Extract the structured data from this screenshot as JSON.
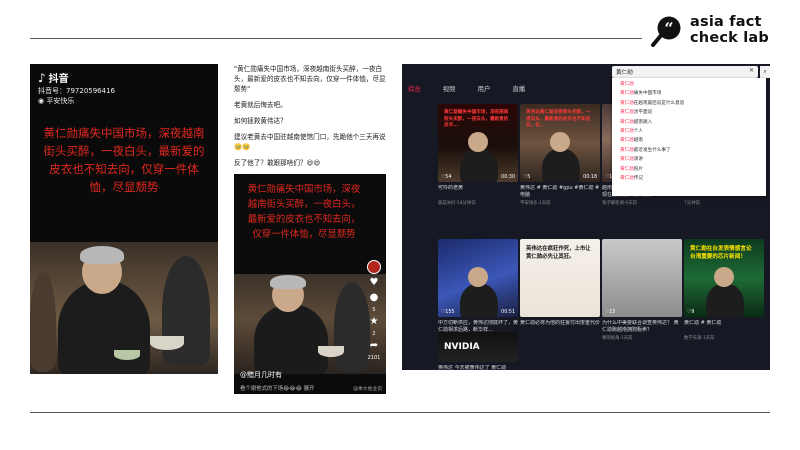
{
  "brand": {
    "line1": "asia fact",
    "line2": "check lab"
  },
  "panel1": {
    "app_name": "抖音",
    "account_id": "抖音号：79720596416",
    "location": "平安快乐",
    "caption": "黄仁勋痛失中国市场，深夜越南街头买醉，一夜白头，最新爱的皮衣也不知去向，仅穿一件体恤，尽显颓势"
  },
  "panel2": {
    "post_paragraphs": [
      "\"黄仁勋痛失中国市场，深夜越南街头买醉，一夜白头，最新爱的皮衣也不知去向，仅穿一件体恤，尽显颓势\"",
      "老黄就后悔去吧。",
      "如何拯救黄伟达？",
      "建议老黄去中国驻越南使馆门口，先跪他个三天再说🥺🥺",
      "反了他了？敢跟那啥们？😄😄"
    ],
    "video_caption": "黄仁勋痛失中国市场，深夜越南街头买醉，一夜白头，最新爱的皮衣也不知去向，仅穿一件体恤，尽显颓势",
    "counts": {
      "comments": "5",
      "share": "2",
      "likes": "2101"
    },
    "subtitle": "@黯月几时有",
    "footer": "看个谢他式的下场😂😂😂 展开",
    "watermark": "@季大他业讯"
  },
  "panel3": {
    "tabs": [
      "综合",
      "视频",
      "用户",
      "直播"
    ],
    "search_value": "黄仁勋",
    "suggestions": [
      {
        "hl": "黄仁勋",
        "rest": ""
      },
      {
        "hl": "黄仁勋",
        "rest": "痛失中国市场"
      },
      {
        "hl": "黄仁勋",
        "rest": "在越南最后说是什么意思"
      },
      {
        "hl": "黄仁勋",
        "rest": "涉平面说"
      },
      {
        "hl": "黄仁勋",
        "rest": "越南跳入"
      },
      {
        "hl": "黄仁勋",
        "rest": "个人"
      },
      {
        "hl": "黄仁勋",
        "rest": "越南"
      },
      {
        "hl": "黄仁勋",
        "rest": "最近发生什么事了"
      },
      {
        "hl": "黄仁勋",
        "rest": "演讲"
      },
      {
        "hl": "黄仁勋",
        "rest": "照片"
      },
      {
        "hl": "黄仁勋",
        "rest": "传记"
      }
    ],
    "cards": [
      {
        "title": "可怜的老黄",
        "meta": "蔬菜米好·54分钟前",
        "stat": "♡54",
        "dur": "00:30",
        "caption": "黄仁勋痛失中国市场，深夜越南街头买醉，一夜白头，最新爱的皮衣..."
      },
      {
        "title": "黄伟达 # 黄仁勋 #gpu #黄仁勋 # 电脑",
        "meta": "平安快乐·1天前",
        "stat": "♡5",
        "dur": "00:18",
        "caption": "英伟达黄仁勋深夜街头买醉，一夜白头，最新爱的皮衣也不知去向，仅..."
      },
      {
        "title": "越南市场的黄仁勋：见了将来多贝，现在赶紧能开发，要捞...",
        "meta": "兔子解新闻·6天前",
        "stat": "♡1264",
        "dur": "00:27",
        "caption": ""
      },
      {
        "title": "黄伟达 # 黄仁勋 #",
        "meta": "7分钟前",
        "stat": "",
        "dur": "00:23",
        "caption": ""
      },
      {
        "title": "中方切断供应，黄伟达彻底坏了，黄仁勋相求后路，断华祥...",
        "meta": "盛宴科研·4天前",
        "stat": "♡155",
        "dur": "00:51",
        "caption": ""
      },
      {
        "title": "黄仁勋必将为他的狂妄付出惨重代价",
        "meta": "",
        "stat": "",
        "dur": "",
        "caption": "英伟达在疯狂作死，上市让黄仁勋必先让其狂。"
      },
      {
        "title": "为什么中美要联合调查英伟达？ 黄仁勋跑越南拥狗贩卖？",
        "meta": "黎明视角·1天前",
        "stat": "♡15",
        "dur": "",
        "caption": ""
      },
      {
        "title": "黄仁勋 # 黄仁勋",
        "meta": "数学先锋·1天前",
        "stat": "♡9",
        "dur": "",
        "caption": "黄仁勋在台发表情感言论 台湾重要的芯片新闻！"
      },
      {
        "title": "英伟达 今天被黄伟达了 黄仁勋",
        "meta": "",
        "stat": "",
        "dur": "",
        "caption": "NVIDIA"
      }
    ],
    "colors": {
      "accent": "#fe2c55",
      "bg": "#161823"
    }
  }
}
